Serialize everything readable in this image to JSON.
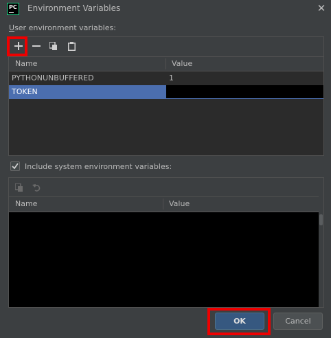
{
  "window": {
    "title": "Environment Variables",
    "app_icon_text": "PC",
    "close_glyph": "✕"
  },
  "user_section": {
    "label_mnemonic": "U",
    "label_rest": "ser environment variables:",
    "toolbar": [
      "add-icon",
      "remove-icon",
      "copy-icon",
      "paste-icon"
    ],
    "columns": [
      "Name",
      "Value"
    ],
    "rows": [
      {
        "name": "PYTHONUNBUFFERED",
        "value": "1"
      },
      {
        "name": "TOKEN",
        "value": ""
      }
    ]
  },
  "include_system": {
    "label": "Include system environment variables:",
    "checked": true
  },
  "system_section": {
    "toolbar": [
      "copy-icon",
      "undo-icon"
    ],
    "columns": [
      "Name",
      "Value"
    ]
  },
  "buttons": {
    "ok_label": "OK",
    "cancel_label": "Cancel"
  },
  "colors": {
    "background": "#3c3f41",
    "table_background": "#2b2b2b",
    "selection": "#4b6eaf",
    "highlight": "#ee0000",
    "ok_button": "#365880"
  }
}
